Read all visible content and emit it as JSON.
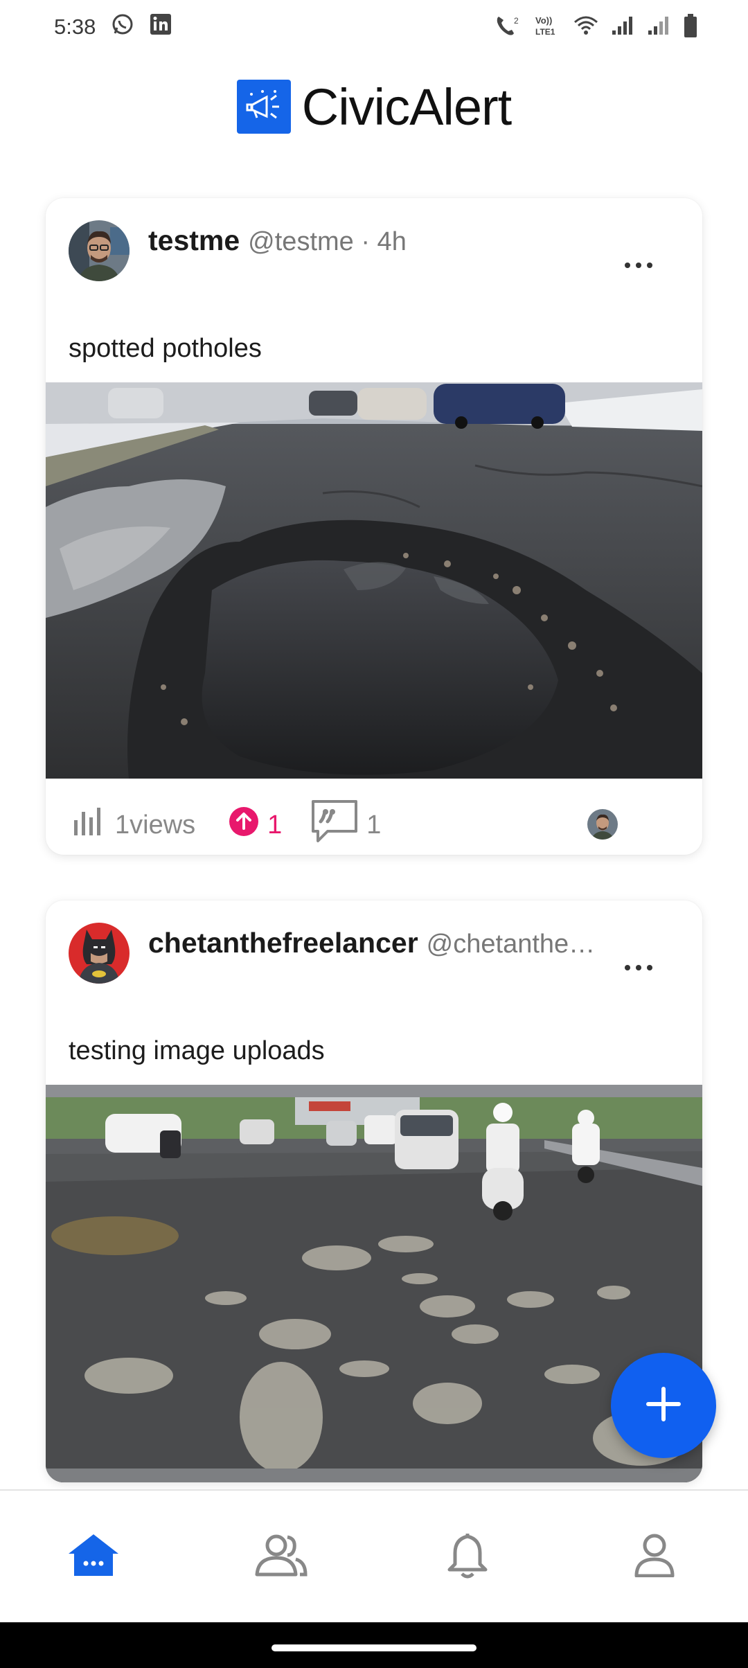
{
  "status_bar": {
    "time": "5:38",
    "left_icons": [
      "whatsapp-icon",
      "linkedin-icon"
    ],
    "right_icons": [
      "wifi-calling-icon",
      "volte-icon",
      "wifi-icon",
      "signal-icon",
      "signal-icon-2",
      "battery-icon"
    ],
    "volte_label": "Vo)) LTE1"
  },
  "header": {
    "logo_icon": "megaphone-icon",
    "title": "CivicAlert"
  },
  "posts": [
    {
      "username": "testme",
      "handle": "@testme · 4h",
      "text": "spotted potholes",
      "image": "pothole-road-photo",
      "views_label": "1views",
      "upvotes": "1",
      "comments": "1",
      "more_icon": "more-horizontal-icon"
    },
    {
      "username": "chetanthefreelancer",
      "handle": "@chetanthe…",
      "text": "testing image uploads",
      "image": "potholed-street-traffic-photo",
      "more_icon": "more-horizontal-icon"
    }
  ],
  "fab": {
    "icon": "plus-icon"
  },
  "bottom_nav": [
    {
      "icon": "home-icon",
      "active": true
    },
    {
      "icon": "community-icon",
      "active": false
    },
    {
      "icon": "bell-icon",
      "active": false
    },
    {
      "icon": "profile-icon",
      "active": false
    }
  ],
  "colors": {
    "accent": "#1565e8",
    "upvote": "#e8186c",
    "text_muted": "#888888"
  }
}
